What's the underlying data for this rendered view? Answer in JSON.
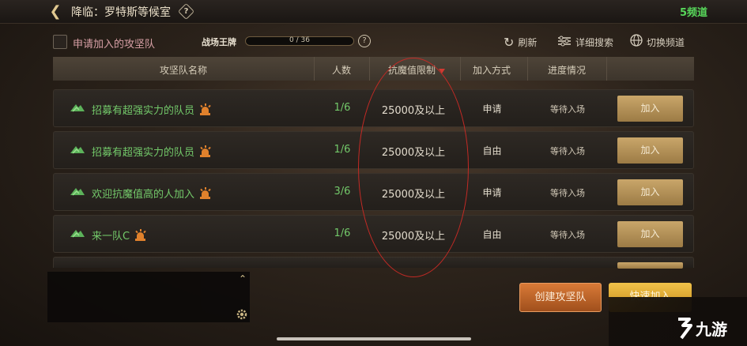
{
  "topbar": {
    "title": "降临：罗特斯等候室",
    "help_label": "?",
    "channel": "5频道"
  },
  "filters": {
    "apply_label": "申请加入的攻坚队",
    "trump_label": "战场王牌",
    "progress_text": "0 / 36",
    "progress_fraction": 0,
    "info_label": "?",
    "refresh_label": "刷新",
    "detail_search_label": "详细搜索",
    "switch_channel_label": "切换频道"
  },
  "table": {
    "columns": {
      "name": "攻坚队名称",
      "count": "人数",
      "limit": "抗魔值限制",
      "mode": "加入方式",
      "progress": "进度情况"
    },
    "rows": [
      {
        "name": "招募有超强实力的队员",
        "count": "1/6",
        "limit": "25000及以上",
        "mode": "申请",
        "progress": "等待入场",
        "button": "加入"
      },
      {
        "name": "招募有超强实力的队员",
        "count": "1/6",
        "limit": "25000及以上",
        "mode": "自由",
        "progress": "等待入场",
        "button": "加入"
      },
      {
        "name": "欢迎抗魔值高的人加入",
        "count": "3/6",
        "limit": "25000及以上",
        "mode": "申请",
        "progress": "等待入场",
        "button": "加入"
      },
      {
        "name": "来一队C",
        "count": "1/6",
        "limit": "25000及以上",
        "mode": "自由",
        "progress": "等待入场",
        "button": "加入"
      }
    ]
  },
  "chat": {
    "up_label": "⌃"
  },
  "actions": {
    "create_label": "创建攻坚队",
    "quick_join_label": "快速加入"
  },
  "watermark": {
    "text": "九游"
  },
  "colors": {
    "team_name": "#73c96a",
    "join_button": "#b8955a",
    "create_button": "#c86a2c",
    "annotation": "#c22a25"
  }
}
